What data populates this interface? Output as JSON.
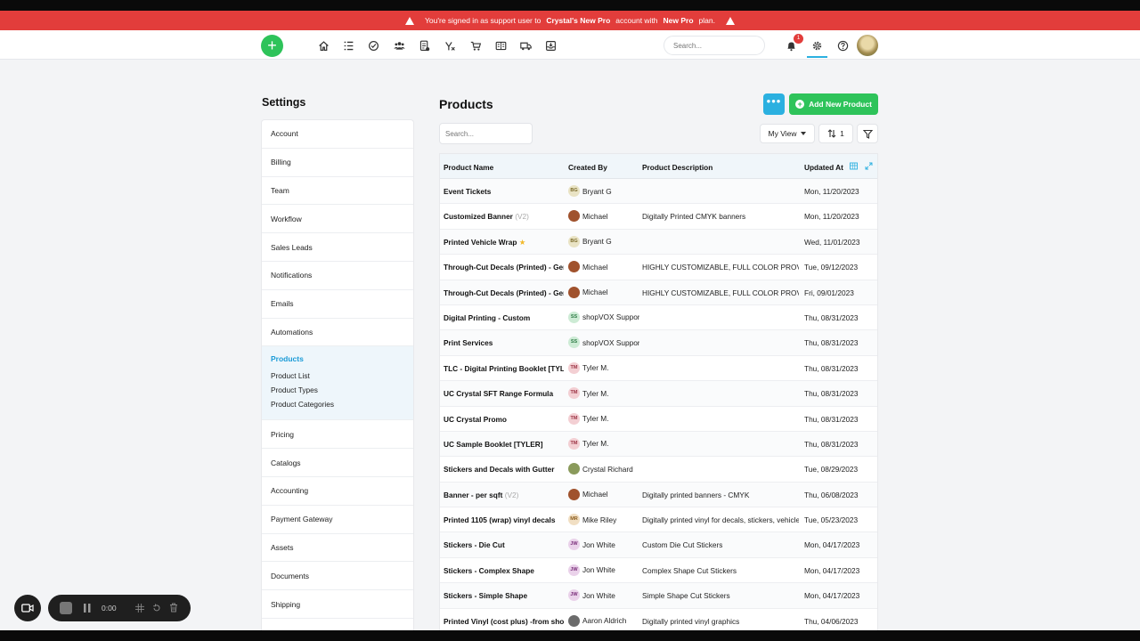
{
  "banner": {
    "prefix": "You're signed in as support user to",
    "account": "Crystal's New Pro",
    "middle": "account with",
    "plan": "New Pro",
    "suffix": "plan."
  },
  "topnav": {
    "search_placeholder": "Search...",
    "notification_count": "1",
    "icons": [
      "home-icon",
      "list-icon",
      "check-circle-icon",
      "customers-icon",
      "quote-icon",
      "formula-icon",
      "cart-icon",
      "catalog-icon",
      "truck-icon",
      "inbox-icon"
    ]
  },
  "sidebar": {
    "title": "Settings",
    "items_before": [
      "Account",
      "Billing",
      "Team",
      "Workflow",
      "Sales Leads",
      "Notifications",
      "Emails",
      "Automations"
    ],
    "active": {
      "label": "Products",
      "subitems": [
        "Product List",
        "Product Types",
        "Product Categories"
      ]
    },
    "items_after": [
      "Pricing",
      "Catalogs",
      "Accounting",
      "Payment Gateway",
      "Assets",
      "Documents",
      "Shipping"
    ]
  },
  "main": {
    "title": "Products",
    "more_label": "•••",
    "add_label": "Add New Product",
    "search_placeholder": "Search...",
    "view_label": "My View",
    "sort_count": "1"
  },
  "table": {
    "headers": [
      "Product Name",
      "Created By",
      "Product Description",
      "Updated At"
    ],
    "rows": [
      {
        "name": "Event Tickets",
        "ver": "",
        "star": false,
        "by": "Bryant G",
        "initials": "BG",
        "av": "#e9e3c4",
        "avfg": "#7a6a2a",
        "desc": "",
        "updated": "Mon, 11/20/2023"
      },
      {
        "name": "Customized Banner",
        "ver": "(V2)",
        "star": false,
        "by": "Michael",
        "initials": "",
        "av": "#a0522d",
        "avfg": "#fff",
        "desc": "Digitally Printed CMYK banners",
        "updated": "Mon, 11/20/2023"
      },
      {
        "name": "Printed Vehicle Wrap",
        "ver": "",
        "star": true,
        "by": "Bryant G",
        "initials": "BG",
        "av": "#e9e3c4",
        "avfg": "#7a6a2a",
        "desc": "",
        "updated": "Wed, 11/01/2023"
      },
      {
        "name": "Through-Cut Decals (Printed) - Generic",
        "ver": "",
        "star": false,
        "by": "Michael",
        "initials": "",
        "av": "#a0522d",
        "avfg": "#fff",
        "desc": "HIGHLY CUSTOMIZABLE, FULL COLOR PROVEN",
        "updated": "Tue, 09/12/2023"
      },
      {
        "name": "Through-Cut Decals (Printed) - Generic",
        "ver": "",
        "star": false,
        "by": "Michael",
        "initials": "",
        "av": "#a0522d",
        "avfg": "#fff",
        "desc": "HIGHLY CUSTOMIZABLE, FULL COLOR PROVEN",
        "updated": "Fri, 09/01/2023"
      },
      {
        "name": "Digital Printing - Custom",
        "ver": "",
        "star": false,
        "by": "shopVOX Support",
        "initials": "SS",
        "av": "#cdebd5",
        "avfg": "#2d7a45",
        "desc": "",
        "updated": "Thu, 08/31/2023"
      },
      {
        "name": "Print Services",
        "ver": "",
        "star": false,
        "by": "shopVOX Support",
        "initials": "SS",
        "av": "#cdebd5",
        "avfg": "#2d7a45",
        "desc": "",
        "updated": "Thu, 08/31/2023"
      },
      {
        "name": "TLC - Digital Printing Booklet [TYLER]",
        "ver": "",
        "star": false,
        "by": "Tyler M.",
        "initials": "TM",
        "av": "#f3cfd3",
        "avfg": "#9a3142",
        "desc": "",
        "updated": "Thu, 08/31/2023"
      },
      {
        "name": "UC Crystal SFT Range Formula",
        "ver": "",
        "star": false,
        "by": "Tyler M.",
        "initials": "TM",
        "av": "#f3cfd3",
        "avfg": "#9a3142",
        "desc": "",
        "updated": "Thu, 08/31/2023"
      },
      {
        "name": "UC Crystal Promo",
        "ver": "",
        "star": false,
        "by": "Tyler M.",
        "initials": "TM",
        "av": "#f3cfd3",
        "avfg": "#9a3142",
        "desc": "",
        "updated": "Thu, 08/31/2023"
      },
      {
        "name": "UC Sample Booklet [TYLER]",
        "ver": "",
        "star": false,
        "by": "Tyler M.",
        "initials": "TM",
        "av": "#f3cfd3",
        "avfg": "#9a3142",
        "desc": "",
        "updated": "Thu, 08/31/2023"
      },
      {
        "name": "Stickers and Decals with Gutter",
        "ver": "",
        "star": false,
        "by": "Crystal Richard",
        "initials": "",
        "av": "#8a9a5b",
        "avfg": "#fff",
        "desc": "",
        "updated": "Tue, 08/29/2023"
      },
      {
        "name": "Banner - per sqft",
        "ver": "(V2)",
        "star": false,
        "by": "Michael",
        "initials": "",
        "av": "#a0522d",
        "avfg": "#fff",
        "desc": "Digitally printed banners - CMYK",
        "updated": "Thu, 06/08/2023"
      },
      {
        "name": "Printed 1105 (wrap) vinyl decals",
        "ver": "",
        "star": false,
        "by": "Mike Riley",
        "initials": "MR",
        "av": "#f1dfc3",
        "avfg": "#8a5a1a",
        "desc": "Digitally printed vinyl for decals, stickers, vehicle",
        "updated": "Tue, 05/23/2023"
      },
      {
        "name": "Stickers - Die Cut",
        "ver": "",
        "star": false,
        "by": "Jon White",
        "initials": "JW",
        "av": "#ead2ea",
        "avfg": "#7a2f7a",
        "desc": "Custom Die Cut Stickers",
        "updated": "Mon, 04/17/2023"
      },
      {
        "name": "Stickers - Complex Shape",
        "ver": "",
        "star": false,
        "by": "Jon White",
        "initials": "JW",
        "av": "#ead2ea",
        "avfg": "#7a2f7a",
        "desc": "Complex Shape Cut Stickers",
        "updated": "Mon, 04/17/2023"
      },
      {
        "name": "Stickers - Simple Shape",
        "ver": "",
        "star": false,
        "by": "Jon White",
        "initials": "JW",
        "av": "#ead2ea",
        "avfg": "#7a2f7a",
        "desc": "Simple Shape Cut Stickers",
        "updated": "Mon, 04/17/2023"
      },
      {
        "name": "Printed Vinyl (cost plus) -from shop",
        "ver": "",
        "star": false,
        "by": "Aaron Aldrich",
        "initials": "",
        "av": "#6b6b6b",
        "avfg": "#fff",
        "desc": "Digitally printed vinyl graphics",
        "updated": "Thu, 04/06/2023"
      }
    ]
  },
  "recorder": {
    "time": "0:00"
  },
  "colors": {
    "banner": "#e23d3b",
    "green": "#2ec35a",
    "blue": "#2bb0e0",
    "active_text": "#1a9bd7"
  }
}
